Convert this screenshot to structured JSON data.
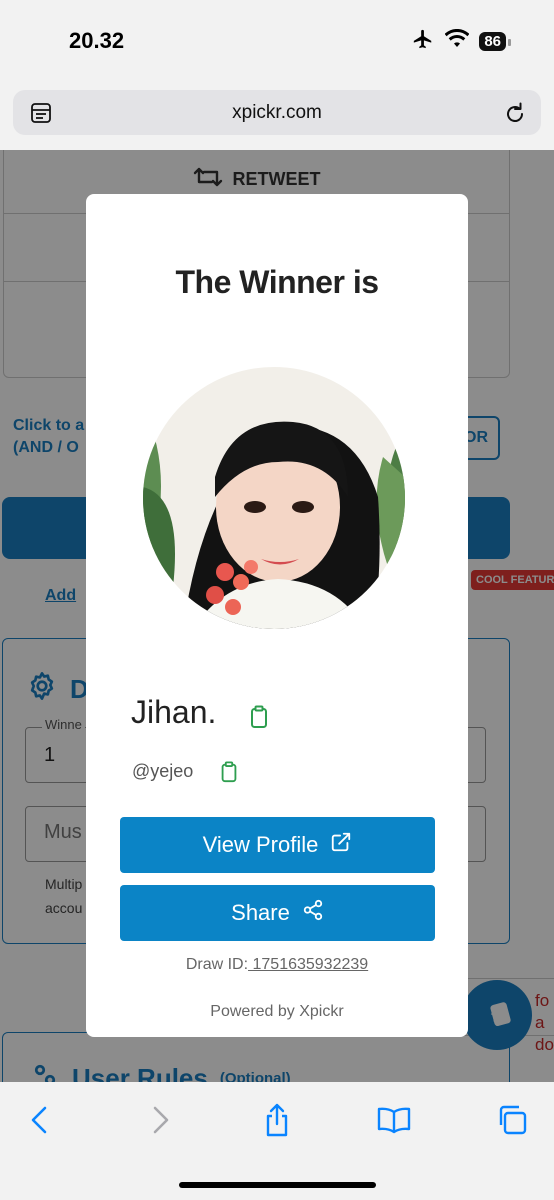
{
  "status_bar": {
    "time": "20.32",
    "battery": "86"
  },
  "browser": {
    "url": "xpickr.com"
  },
  "background_page": {
    "retweet_label": "RETWEET",
    "click_text_line1": "Click to a",
    "click_text_line2": "(AND / O",
    "and_or_button": "OR",
    "add_link": "Add",
    "cool_badge": "COOL FEATUR",
    "settings_title": "D",
    "winners_label": "Winne",
    "winners_value": "1",
    "must_placeholder": "Mus",
    "multi_text_line1": "Multip",
    "multi_text_line2": "accou",
    "rules_title": "User Rules",
    "rules_optional": "(Optional)",
    "help_text_line1": "fo",
    "help_text_line2": "a do"
  },
  "modal": {
    "title": "The Winner is",
    "winner_name": "Jihan.",
    "winner_handle": "@yejeo",
    "view_profile_label": "View Profile",
    "share_label": "Share",
    "draw_id_label": "Draw ID:",
    "draw_id_value": " 1751635932239",
    "powered_by": "Powered by Xpickr"
  },
  "colors": {
    "accent": "#0b84c6",
    "copy_icon": "#2e9e4f",
    "badge": "#e53935"
  },
  "icons": [
    "airplane-icon",
    "wifi-icon",
    "battery-icon",
    "reader-icon",
    "reload-icon",
    "retweet-icon",
    "gear-icon",
    "copy-icon",
    "external-link-icon",
    "share-icon",
    "back-icon",
    "forward-icon",
    "share-sheet-icon",
    "bookmarks-icon",
    "tabs-icon"
  ]
}
